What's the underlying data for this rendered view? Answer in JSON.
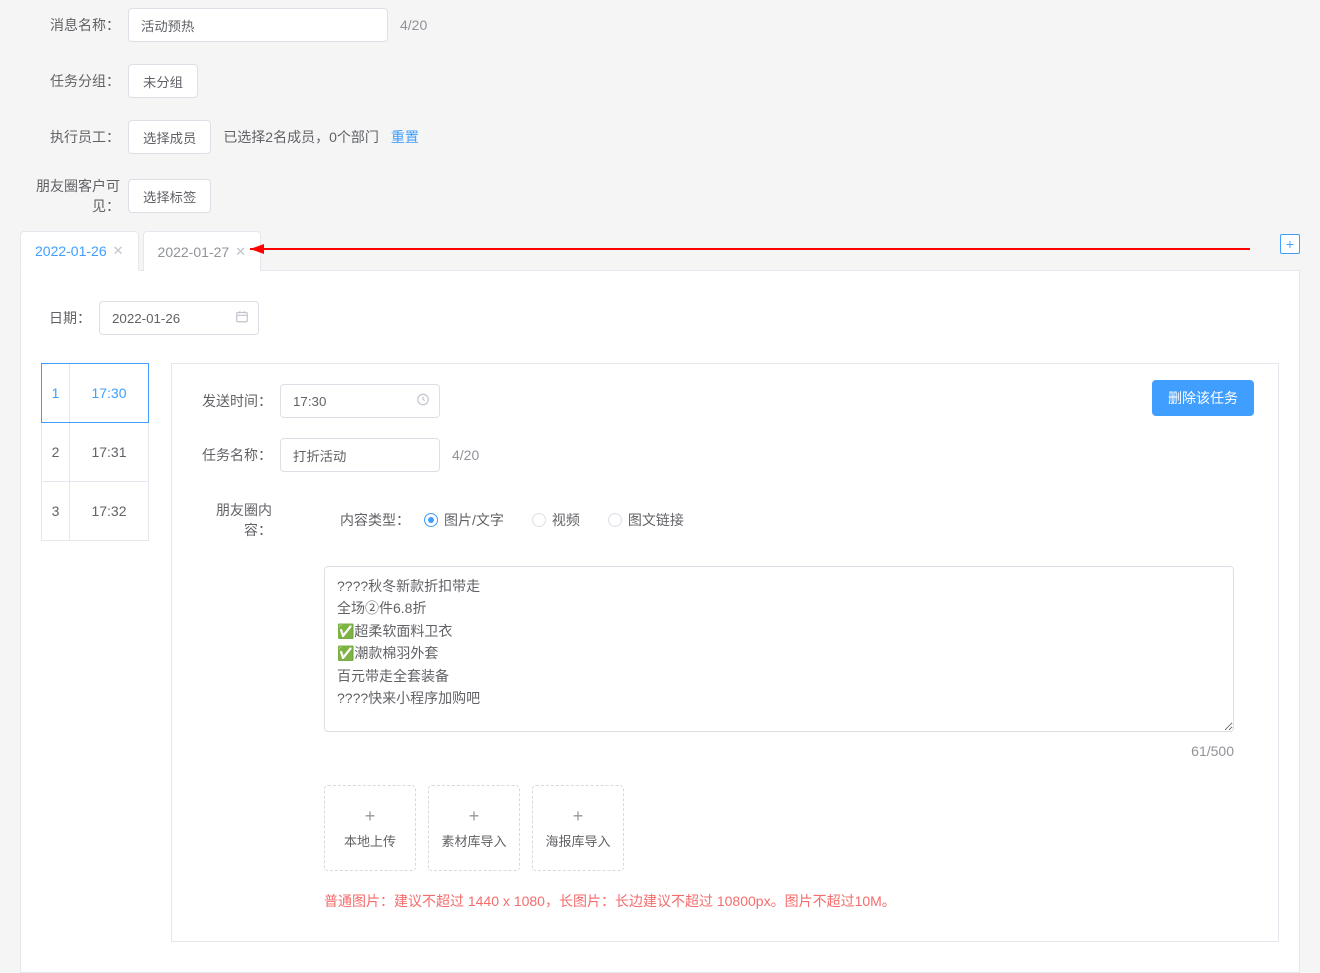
{
  "form": {
    "message_name_label": "消息名称：",
    "message_name_value": "活动预热",
    "message_name_counter": "4/20",
    "task_group_label": "任务分组：",
    "task_group_button": "未分组",
    "executor_label": "执行员工：",
    "executor_button": "选择成员",
    "executor_info": "已选择2名成员，0个部门",
    "reset_link": "重置",
    "visibility_label": "朋友圈客户可见：",
    "visibility_button": "选择标签"
  },
  "tabs": {
    "items": [
      {
        "label": "2022-01-26",
        "active": true
      },
      {
        "label": "2022-01-27",
        "active": false
      }
    ]
  },
  "date": {
    "label": "日期：",
    "value": "2022-01-26"
  },
  "time_list": [
    {
      "num": "1",
      "time": "17:30",
      "active": true
    },
    {
      "num": "2",
      "time": "17:31",
      "active": false
    },
    {
      "num": "3",
      "time": "17:32",
      "active": false
    }
  ],
  "task": {
    "delete_button": "删除该任务",
    "send_time_label": "发送时间：",
    "send_time_value": "17:30",
    "task_name_label": "任务名称：",
    "task_name_value": "打折活动",
    "task_name_counter": "4/20",
    "content_label": "朋友圈内容：",
    "content_type_label": "内容类型：",
    "radios": {
      "image_text": "图片/文字",
      "video": "视频",
      "link": "图文链接"
    },
    "textarea_value": "????秋冬新款折扣带走\n全场②件6.8折\n✅超柔软面料卫衣\n✅潮款棉羽外套\n百元带走全套装备\n????快来小程序加购吧",
    "char_count": "61/500",
    "upload": {
      "local": "本地上传",
      "material": "素材库导入",
      "poster": "海报库导入"
    },
    "hint": "普通图片：建议不超过 1440 x 1080，长图片：长边建议不超过 10800px。图片不超过10M。"
  }
}
